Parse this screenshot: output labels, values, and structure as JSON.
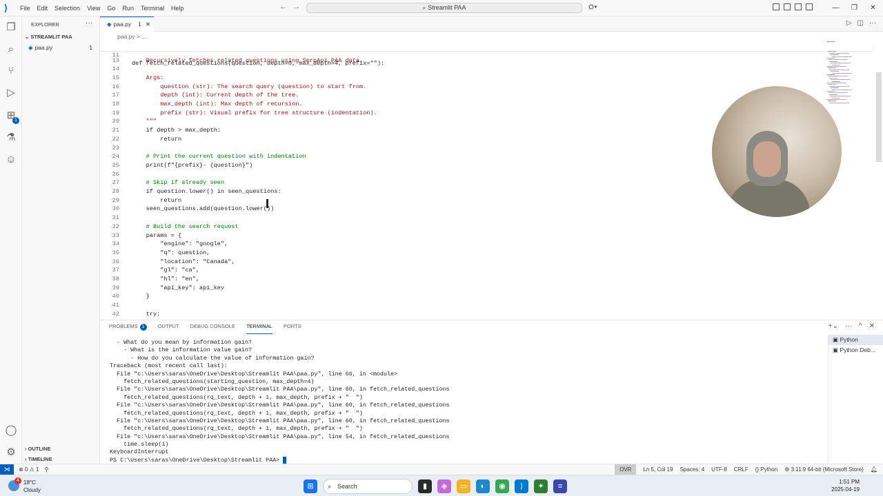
{
  "titlebar": {
    "menus": [
      "File",
      "Edit",
      "Selection",
      "View",
      "Go",
      "Run",
      "Terminal",
      "Help"
    ],
    "command_center": "Streamlit PAA"
  },
  "sidebar": {
    "header": "EXPLORER",
    "folder": "STREAMLIT PAA",
    "file": "paa.py",
    "file_problems": "1",
    "outline": "OUTLINE",
    "timeline": "TIMELINE"
  },
  "tab": {
    "name": "paa.py",
    "problems": "1"
  },
  "breadcrumb": "paa.py > ...",
  "editor": {
    "sticky": {
      "ln": "11",
      "code": "def fetch_related_questions(question, depth=0, max_depth=4, prefix=\"\"):"
    },
    "lines": [
      {
        "ln": "13",
        "code": "    Recursively fetches related questions using SerpApi PAA data."
      },
      {
        "ln": "14",
        "code": ""
      },
      {
        "ln": "15",
        "code": "    Args:"
      },
      {
        "ln": "16",
        "code": "        question (str): The search query (question) to start from."
      },
      {
        "ln": "17",
        "code": "        depth (int): Current depth of the tree."
      },
      {
        "ln": "18",
        "code": "        max_depth (int): Max depth of recursion."
      },
      {
        "ln": "19",
        "code": "        prefix (str): Visual prefix for tree structure (indentation)."
      },
      {
        "ln": "20",
        "code": "    \"\"\""
      },
      {
        "ln": "21",
        "code": "    if depth > max_depth:"
      },
      {
        "ln": "22",
        "code": "        return"
      },
      {
        "ln": "23",
        "code": ""
      },
      {
        "ln": "24",
        "code": "    # Print the current question with indentation"
      },
      {
        "ln": "25",
        "code": "    print(f\"{prefix}- {question}\")"
      },
      {
        "ln": "26",
        "code": ""
      },
      {
        "ln": "27",
        "code": "    # Skip if already seen"
      },
      {
        "ln": "28",
        "code": "    if question.lower() in seen_questions:"
      },
      {
        "ln": "29",
        "code": "        return"
      },
      {
        "ln": "30",
        "code": "    seen_questions.add(question.lower())"
      },
      {
        "ln": "31",
        "code": ""
      },
      {
        "ln": "32",
        "code": "    # Build the search request"
      },
      {
        "ln": "33",
        "code": "    params = {"
      },
      {
        "ln": "34",
        "code": "        \"engine\": \"google\","
      },
      {
        "ln": "35",
        "code": "        \"q\": question,"
      },
      {
        "ln": "36",
        "code": "        \"location\": \"Canada\","
      },
      {
        "ln": "37",
        "code": "        \"gl\": \"ca\","
      },
      {
        "ln": "38",
        "code": "        \"hl\": \"en\","
      },
      {
        "ln": "39",
        "code": "        \"api_key\": api_key"
      },
      {
        "ln": "40",
        "code": "    }"
      },
      {
        "ln": "41",
        "code": ""
      },
      {
        "ln": "42",
        "code": "    try:"
      }
    ]
  },
  "panel": {
    "tabs": [
      "PROBLEMS",
      "OUTPUT",
      "DEBUG CONSOLE",
      "TERMINAL",
      "PORTS"
    ],
    "problems_count": "1",
    "terminal_lines": [
      "  - What do you mean by information gain?",
      "    - What is the information value gain?",
      "      - How do you calculate the value of information gain?",
      "Traceback (most recent call last):",
      "  File \"c:\\Users\\saras\\OneDrive\\Desktop\\Streamlit PAA\\paa.py\", line 66, in <module>",
      "    fetch_related_questions(starting_question, max_depth=4)",
      "  File \"c:\\Users\\saras\\OneDrive\\Desktop\\Streamlit PAA\\paa.py\", line 60, in fetch_related_questions",
      "    fetch_related_questions(rq_text, depth + 1, max_depth, prefix + \"  \")",
      "  File \"c:\\Users\\saras\\OneDrive\\Desktop\\Streamlit PAA\\paa.py\", line 60, in fetch_related_questions",
      "    fetch_related_questions(rq_text, depth + 1, max_depth, prefix + \"  \")",
      "  File \"c:\\Users\\saras\\OneDrive\\Desktop\\Streamlit PAA\\paa.py\", line 60, in fetch_related_questions",
      "    fetch_related_questions(rq_text, depth + 1, max_depth, prefix + \"  \")",
      "  File \"c:\\Users\\saras\\OneDrive\\Desktop\\Streamlit PAA\\paa.py\", line 54, in fetch_related_questions",
      "    time.sleep(1)",
      "KeyboardInterrupt"
    ],
    "prompt": "PS C:\\Users\\saras\\OneDrive\\Desktop\\Streamlit PAA> ",
    "terminals": [
      "Python",
      "Python Deb..."
    ]
  },
  "statusbar": {
    "errors": "0",
    "warnings": "1",
    "ovr": "OVR",
    "position": "Ln 5, Col 19",
    "spaces": "Spaces: 4",
    "encoding": "UTF-8",
    "eol": "CRLF",
    "language": "Python",
    "interpreter": "3.11.9 64-bit (Microsoft Store)"
  },
  "taskbar": {
    "temp": "18°C",
    "condition": "Cloudy",
    "weather_badge": "4",
    "search": "Search",
    "time": "1:51 PM",
    "date": "2025-04-19"
  },
  "colors": {
    "accent": "#005fb8",
    "comment": "#008000",
    "string": "#a31515",
    "keyword": "#af00db"
  }
}
